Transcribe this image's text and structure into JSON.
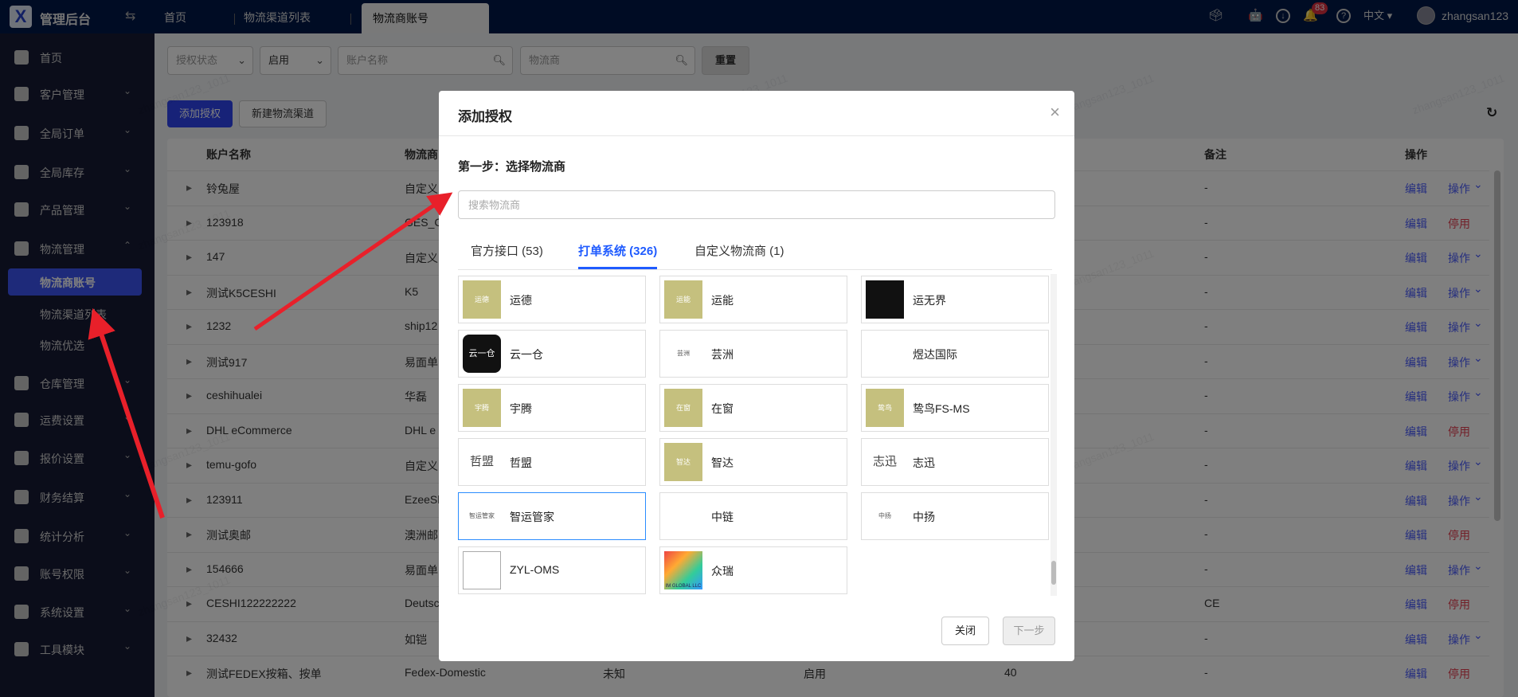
{
  "app": {
    "title": "管理后台",
    "logo": "X"
  },
  "tabs": [
    {
      "label": "首页"
    },
    {
      "label": "物流渠道列表"
    },
    {
      "label": "物流商账号"
    }
  ],
  "topbar": {
    "notification_count": "83",
    "language": "中文 ▾",
    "username": "zhangsan123"
  },
  "sidebar": {
    "items": [
      {
        "label": "首页",
        "icon": "home-icon"
      },
      {
        "label": "客户管理",
        "icon": "users-icon"
      },
      {
        "label": "全局订单",
        "icon": "clipboard-icon"
      },
      {
        "label": "全局库存",
        "icon": "warehouse-icon"
      },
      {
        "label": "产品管理",
        "icon": "box-icon"
      },
      {
        "label": "物流管理",
        "icon": "truck-icon"
      },
      {
        "label": "仓库管理",
        "icon": "storehouse-icon"
      },
      {
        "label": "运费设置",
        "icon": "freight-icon"
      },
      {
        "label": "报价设置",
        "icon": "quote-icon"
      },
      {
        "label": "财务结算",
        "icon": "dollar-icon"
      },
      {
        "label": "统计分析",
        "icon": "chart-icon"
      },
      {
        "label": "账号权限",
        "icon": "org-icon"
      },
      {
        "label": "系统设置",
        "icon": "settings-icon"
      },
      {
        "label": "工具模块",
        "icon": "wrench-icon"
      }
    ],
    "sub_items": [
      {
        "label": "物流商账号"
      },
      {
        "label": "物流渠道列表"
      },
      {
        "label": "物流优选"
      }
    ]
  },
  "filters": {
    "auth_status_placeholder": "授权状态",
    "status_value": "启用",
    "account_placeholder": "账户名称",
    "carrier_placeholder": "物流商",
    "reset_label": "重置"
  },
  "toolbar": {
    "add_auth_label": "添加授权",
    "new_channel_label": "新建物流渠道"
  },
  "table": {
    "headers": {
      "account": "账户名称",
      "carrier": "物流商",
      "remark": "备注",
      "actions": "操作"
    },
    "edit_label": "编辑",
    "rows": [
      {
        "account": "铃兔屋",
        "carrier": "自定义",
        "remark": "-",
        "action": "操作",
        "action_type": "menu"
      },
      {
        "account": "123918",
        "carrier": "GES_CA",
        "remark": "-",
        "action": "停用",
        "action_type": "danger"
      },
      {
        "account": "147",
        "carrier": "自定义",
        "remark": "-",
        "action": "操作",
        "action_type": "menu"
      },
      {
        "account": "测试K5CESHI",
        "carrier": "K5",
        "remark": "-",
        "action": "操作",
        "action_type": "menu"
      },
      {
        "account": "1232",
        "carrier": "ship12",
        "remark": "-",
        "action": "操作",
        "action_type": "menu"
      },
      {
        "account": "测试917",
        "carrier": "易面单",
        "remark": "-",
        "action": "操作",
        "action_type": "menu"
      },
      {
        "account": "ceshihualei",
        "carrier": "华磊",
        "remark": "-",
        "action": "操作",
        "action_type": "menu"
      },
      {
        "account": "DHL eCommerce",
        "carrier": "DHL e",
        "remark": "-",
        "action": "停用",
        "action_type": "danger"
      },
      {
        "account": "temu-gofo",
        "carrier": "自定义",
        "remark": "-",
        "action": "操作",
        "action_type": "menu"
      },
      {
        "account": "123911",
        "carrier": "EzeeSh",
        "remark": "-",
        "action": "操作",
        "action_type": "menu"
      },
      {
        "account": "测试奥邮",
        "carrier": "澳洲邮",
        "remark": "-",
        "action": "停用",
        "action_type": "danger"
      },
      {
        "account": "154666",
        "carrier": "易面单",
        "remark": "-",
        "action": "操作",
        "action_type": "menu"
      },
      {
        "account": "CESHI122222222",
        "carrier": "Deutsc",
        "remark": "CE",
        "action": "停用",
        "action_type": "danger"
      },
      {
        "account": "32432",
        "carrier": "如铠",
        "remark": "-",
        "action": "操作",
        "action_type": "menu"
      },
      {
        "account": "测试FEDEX按箱、按单",
        "carrier": "Fedex-Domestic",
        "col3": "未知",
        "status": "启用",
        "col5": "40",
        "remark": "-",
        "action": "停用",
        "action_type": "danger"
      }
    ]
  },
  "modal": {
    "title": "添加授权",
    "step": "第一步：选择物流商",
    "search_placeholder": "搜索物流商",
    "tabs": [
      {
        "label": "官方接口 (53)"
      },
      {
        "label": "打单系统 (326)"
      },
      {
        "label": "自定义物流商 (1)"
      }
    ],
    "carriers": [
      {
        "name": "运德",
        "logo_text": "运德",
        "logo": "placeholder"
      },
      {
        "name": "运能",
        "logo_text": "运能",
        "logo": "placeholder"
      },
      {
        "name": "运无界",
        "logo_text": "",
        "logo": "orange-y"
      },
      {
        "name": "云一仓",
        "logo_text": "云一仓",
        "logo": "dark"
      },
      {
        "name": "芸洲",
        "logo_text": "芸洲",
        "logo": "text"
      },
      {
        "name": "煜达国际",
        "logo_text": "",
        "logo": "globe"
      },
      {
        "name": "宇腾",
        "logo_text": "宇腾",
        "logo": "placeholder"
      },
      {
        "name": "在窗",
        "logo_text": "在窗",
        "logo": "placeholder"
      },
      {
        "name": "鸷鸟FS-MS",
        "logo_text": "鸷鸟",
        "logo": "placeholder"
      },
      {
        "name": "哲盟",
        "logo_text": "哲盟",
        "logo": "bigtext"
      },
      {
        "name": "智达",
        "logo_text": "智达",
        "logo": "placeholder"
      },
      {
        "name": "志迅",
        "logo_text": "志迅",
        "logo": "bigtext"
      },
      {
        "name": "智运管家",
        "logo_text": "智运管家",
        "logo": "text"
      },
      {
        "name": "中链",
        "logo_text": "",
        "logo": "whale"
      },
      {
        "name": "中扬",
        "logo_text": "中扬",
        "logo": "text"
      },
      {
        "name": "ZYL-OMS",
        "logo_text": "",
        "logo": "broken"
      },
      {
        "name": "众瑞",
        "logo_text": "IM GLOBAL LLC",
        "logo": "stripes"
      }
    ],
    "selected_index": 12,
    "close_label": "关闭",
    "next_label": "下一步"
  },
  "watermark": "zhangsan123_1011",
  "colors": {
    "primary": "#2e45f0",
    "danger": "#e53e50",
    "link": "#4a5cff",
    "placeholder_logo": "#c5c07e"
  }
}
